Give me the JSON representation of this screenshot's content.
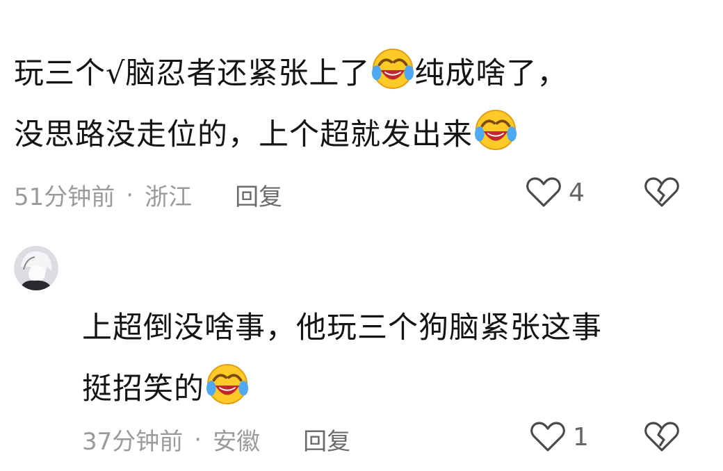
{
  "comment1": {
    "line1_before": "玩三个√脑忍者还紧张上了",
    "line1_after": "纯成啥了，",
    "line2": "没思路没走位的，上个超就发出来",
    "time": "51分钟前",
    "location": "浙江",
    "reply_label": "回复",
    "likes": "4"
  },
  "comment2": {
    "line1": "上超倒没啥事，他玩三个狗脑紧张这事",
    "line2": "挺招笑的",
    "time": "37分钟前",
    "location": "安徽",
    "reply_label": "回复",
    "likes": "1"
  },
  "separator": "·",
  "icons": {
    "emoji": "laughing-crying-emoji-icon",
    "like": "heart-outline-icon",
    "dislike": "broken-heart-icon"
  }
}
